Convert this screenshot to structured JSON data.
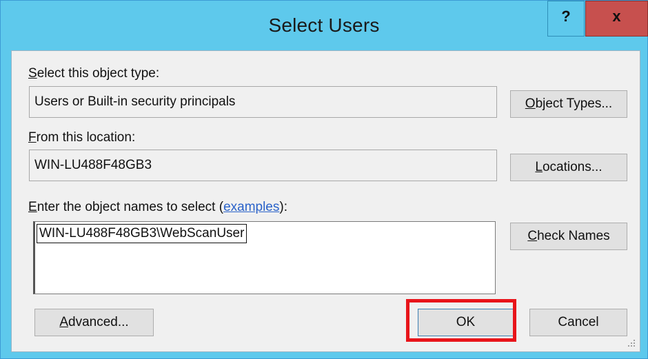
{
  "window": {
    "title": "Select Users",
    "help_glyph": "?",
    "close_glyph": "x"
  },
  "object_type": {
    "label_accel": "S",
    "label_rest": "elect this object type:",
    "value": "Users or Built-in security principals",
    "button_accel": "O",
    "button_rest": "bject Types..."
  },
  "location": {
    "label_accel": "F",
    "label_rest": "rom this location:",
    "value": "WIN-LU488F48GB3",
    "button_accel": "L",
    "button_rest": "ocations..."
  },
  "names": {
    "label_accel": "E",
    "label_rest": "nter the object names to select (",
    "link": "examples",
    "label_end": "):",
    "value": "WIN-LU488F48GB3\\WebScanUser",
    "check_accel": "C",
    "check_rest": "heck Names"
  },
  "footer": {
    "advanced_accel": "A",
    "advanced_rest": "dvanced...",
    "ok": "OK",
    "cancel": "Cancel"
  },
  "colors": {
    "titlebar": "#5ec9ec",
    "close": "#c7504e",
    "highlight": "#e8141a"
  },
  "icons": {
    "help": "help-icon",
    "close": "close-icon",
    "grip": "resize-grip-icon"
  }
}
